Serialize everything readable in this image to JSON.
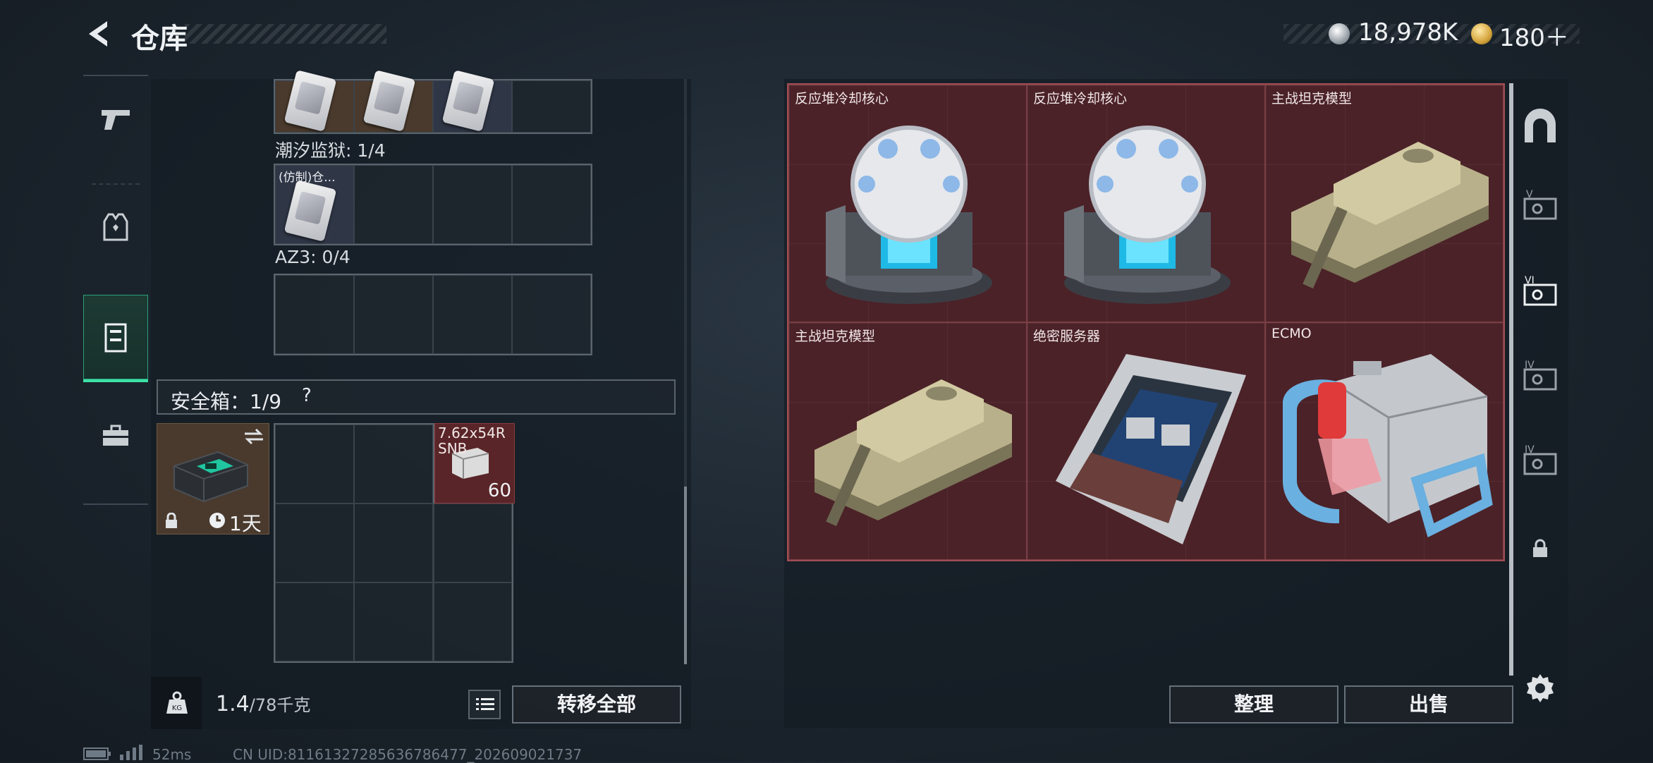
{
  "header": {
    "title": "仓库",
    "currency_primary": "18,978K",
    "currency_secondary": "180＋"
  },
  "left_tabs": [
    {
      "name": "weapons-tab",
      "icon": "pistol-icon",
      "active": false
    },
    {
      "name": "equipment-tab",
      "icon": "vest-icon",
      "active": false
    },
    {
      "name": "container-tab",
      "icon": "locker-icon",
      "active": true
    },
    {
      "name": "toolbox-tab",
      "icon": "briefcase-icon",
      "active": false
    }
  ],
  "containers": {
    "tide_prison_label": "潮汐监狱: 1/4",
    "az3_label": "AZ3: 0/4",
    "card_item_label": "(仿制)仓..."
  },
  "safebox": {
    "title": "安全箱：1/9",
    "help": "?",
    "duration": "1天",
    "ammo": {
      "name": "7.62x54R SNB",
      "count": "60"
    }
  },
  "bottom_left": {
    "weight_current": "1.4",
    "weight_max": "/78千克",
    "transfer_all": "转移全部"
  },
  "stash_items": [
    {
      "name": "反应堆冷却核心",
      "kind": "reactor"
    },
    {
      "name": "反应堆冷却核心",
      "kind": "reactor"
    },
    {
      "name": "主战坦克模型",
      "kind": "tank"
    },
    {
      "name": "主战坦克模型",
      "kind": "tank"
    },
    {
      "name": "绝密服务器",
      "kind": "server"
    },
    {
      "name": "ECMO",
      "kind": "ecmo"
    }
  ],
  "bottom_right": {
    "sort": "整理",
    "sell": "出售"
  },
  "footer": {
    "ping": "52ms",
    "uid": "CN UID:81161327285636786477_202609021737"
  },
  "colors": {
    "accent_green": "#3ee2a6",
    "stash_red": "#4b2228",
    "item_brown": "#4a3a2d"
  }
}
